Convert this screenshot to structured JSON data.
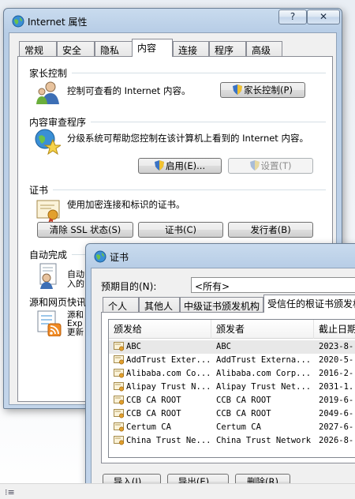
{
  "ie_window": {
    "title": "Internet 属性",
    "help_button": "?",
    "close_button": "✕",
    "tabs": [
      "常规",
      "安全",
      "隐私",
      "内容",
      "连接",
      "程序",
      "高级"
    ],
    "active_tab": "内容",
    "parental": {
      "heading": "家长控制",
      "description": "控制可查看的 Internet 内容。",
      "button": "家长控制(P)"
    },
    "advisor": {
      "heading": "内容审查程序",
      "description": "分级系统可帮助您控制在该计算机上看到的 Internet 内容。",
      "enable_button": "启用(E)...",
      "settings_button": "设置(T)"
    },
    "certificates": {
      "heading": "证书",
      "description": "使用加密连接和标识的证书。",
      "clear_ssl_button": "清除 SSL 状态(S)",
      "certs_button": "证书(C)",
      "publishers_button": "发行者(B)"
    },
    "autocomplete": {
      "heading": "自动完成",
      "description_partial": "自动\n入的"
    },
    "feeds": {
      "heading": "源和网页快讯",
      "description_partial": "源和\nExp\n更新"
    }
  },
  "cert_window": {
    "title": "证书",
    "purpose_label": "预期目的(N):",
    "purpose_value": "<所有>",
    "tabs": [
      "个人",
      "其他人",
      "中级证书颁发机构",
      "受信任的根证书颁发机"
    ],
    "active_tab_index": 3,
    "columns": [
      "颁发给",
      "颁发者",
      "截止日期"
    ],
    "rows": [
      {
        "issued_to": "ABC",
        "issued_by": "ABC",
        "expires": "2023-8-"
      },
      {
        "issued_to": "AddTrust Exter...",
        "issued_by": "AddTrust Externa...",
        "expires": "2020-5-"
      },
      {
        "issued_to": "Alibaba.com Co...",
        "issued_by": "Alibaba.com Corp...",
        "expires": "2016-2-"
      },
      {
        "issued_to": "Alipay Trust N...",
        "issued_by": "Alipay Trust Net...",
        "expires": "2031-1."
      },
      {
        "issued_to": "CCB CA ROOT",
        "issued_by": "CCB CA ROOT",
        "expires": "2019-6-"
      },
      {
        "issued_to": "CCB CA ROOT",
        "issued_by": "CCB CA ROOT",
        "expires": "2049-6-"
      },
      {
        "issued_to": "Certum CA",
        "issued_by": "Certum CA",
        "expires": "2027-6-"
      },
      {
        "issued_to": "China Trust Ne...",
        "issued_by": "China Trust Network",
        "expires": "2026-8-"
      }
    ],
    "import_button": "导入(I)...",
    "export_button": "导出(E)...",
    "remove_button": "删除(R)"
  },
  "taskbar": {
    "glyph": "⁝≡"
  }
}
